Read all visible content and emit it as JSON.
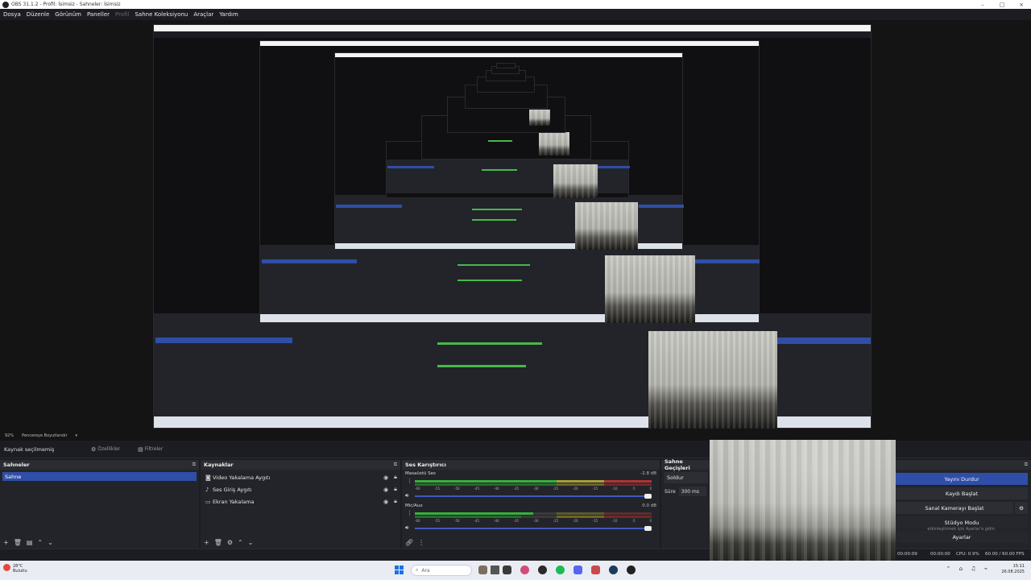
{
  "window": {
    "title": "OBS 31.1.2 - Profil: İsimsiz - Sahneler: İsimsiz",
    "buttons": [
      "–",
      "□",
      "×"
    ]
  },
  "menu": {
    "items": [
      "Dosya",
      "Düzenle",
      "Görünüm",
      "Paneller",
      "Profil",
      "Sahne Koleksiyonu",
      "Araçlar",
      "Yardım"
    ]
  },
  "zoom": {
    "level": "92%",
    "mode": "Pencereye Boyutlandır"
  },
  "source_bar": {
    "label": "Kaynak seçilmemiş",
    "properties": "Özellikler",
    "filters": "Filtreler"
  },
  "scenes": {
    "title": "Sahneler",
    "items": [
      "Sahne"
    ]
  },
  "sources": {
    "title": "Kaynaklar",
    "items": [
      {
        "name": "Video Yakalama Aygıtı",
        "icon": "camera-icon"
      },
      {
        "name": "Ses Giriş Aygıtı",
        "icon": "microphone-icon"
      },
      {
        "name": "Ekran Yakalama",
        "icon": "monitor-icon"
      }
    ]
  },
  "mixer": {
    "title": "Ses Karıştırıcı",
    "channels": [
      {
        "name": "Masaüstü Ses",
        "db": "-2.8 dB",
        "level": 0.82
      },
      {
        "name": "Mic/Aux",
        "db": "0.0 dB",
        "level": 0.55
      }
    ],
    "ticks": [
      "-60",
      "-55",
      "-50",
      "-45",
      "-40",
      "-35",
      "-30",
      "-25",
      "-20",
      "-15",
      "-10",
      "-5",
      "0"
    ]
  },
  "transitions": {
    "title": "Sahne Geçişleri",
    "selected": "Soldur",
    "duration_label": "Süre",
    "duration_value": "300 ms"
  },
  "controls": {
    "stop_stream": "Yayını Durdur",
    "start_recording": "Kaydı Başlat",
    "virtual_camera": "Sanal Kamerayı Başlat",
    "studio_mode": "Stüdyo Modu",
    "settings": "Ayarlar",
    "activation_hint": "etkinleştirmek için Ayarlar'a gidin."
  },
  "status": {
    "stream_time": "00:00:09",
    "record_time": "00:00:00",
    "cpu": "CPU: 0.9%",
    "fps": "60.00 / 60.00 FPS"
  },
  "taskbar": {
    "weather_temp": "28°C",
    "weather_desc": "Bulutlu",
    "search_placeholder": "Ara",
    "time": "15:11",
    "date": "26.08.2025"
  }
}
